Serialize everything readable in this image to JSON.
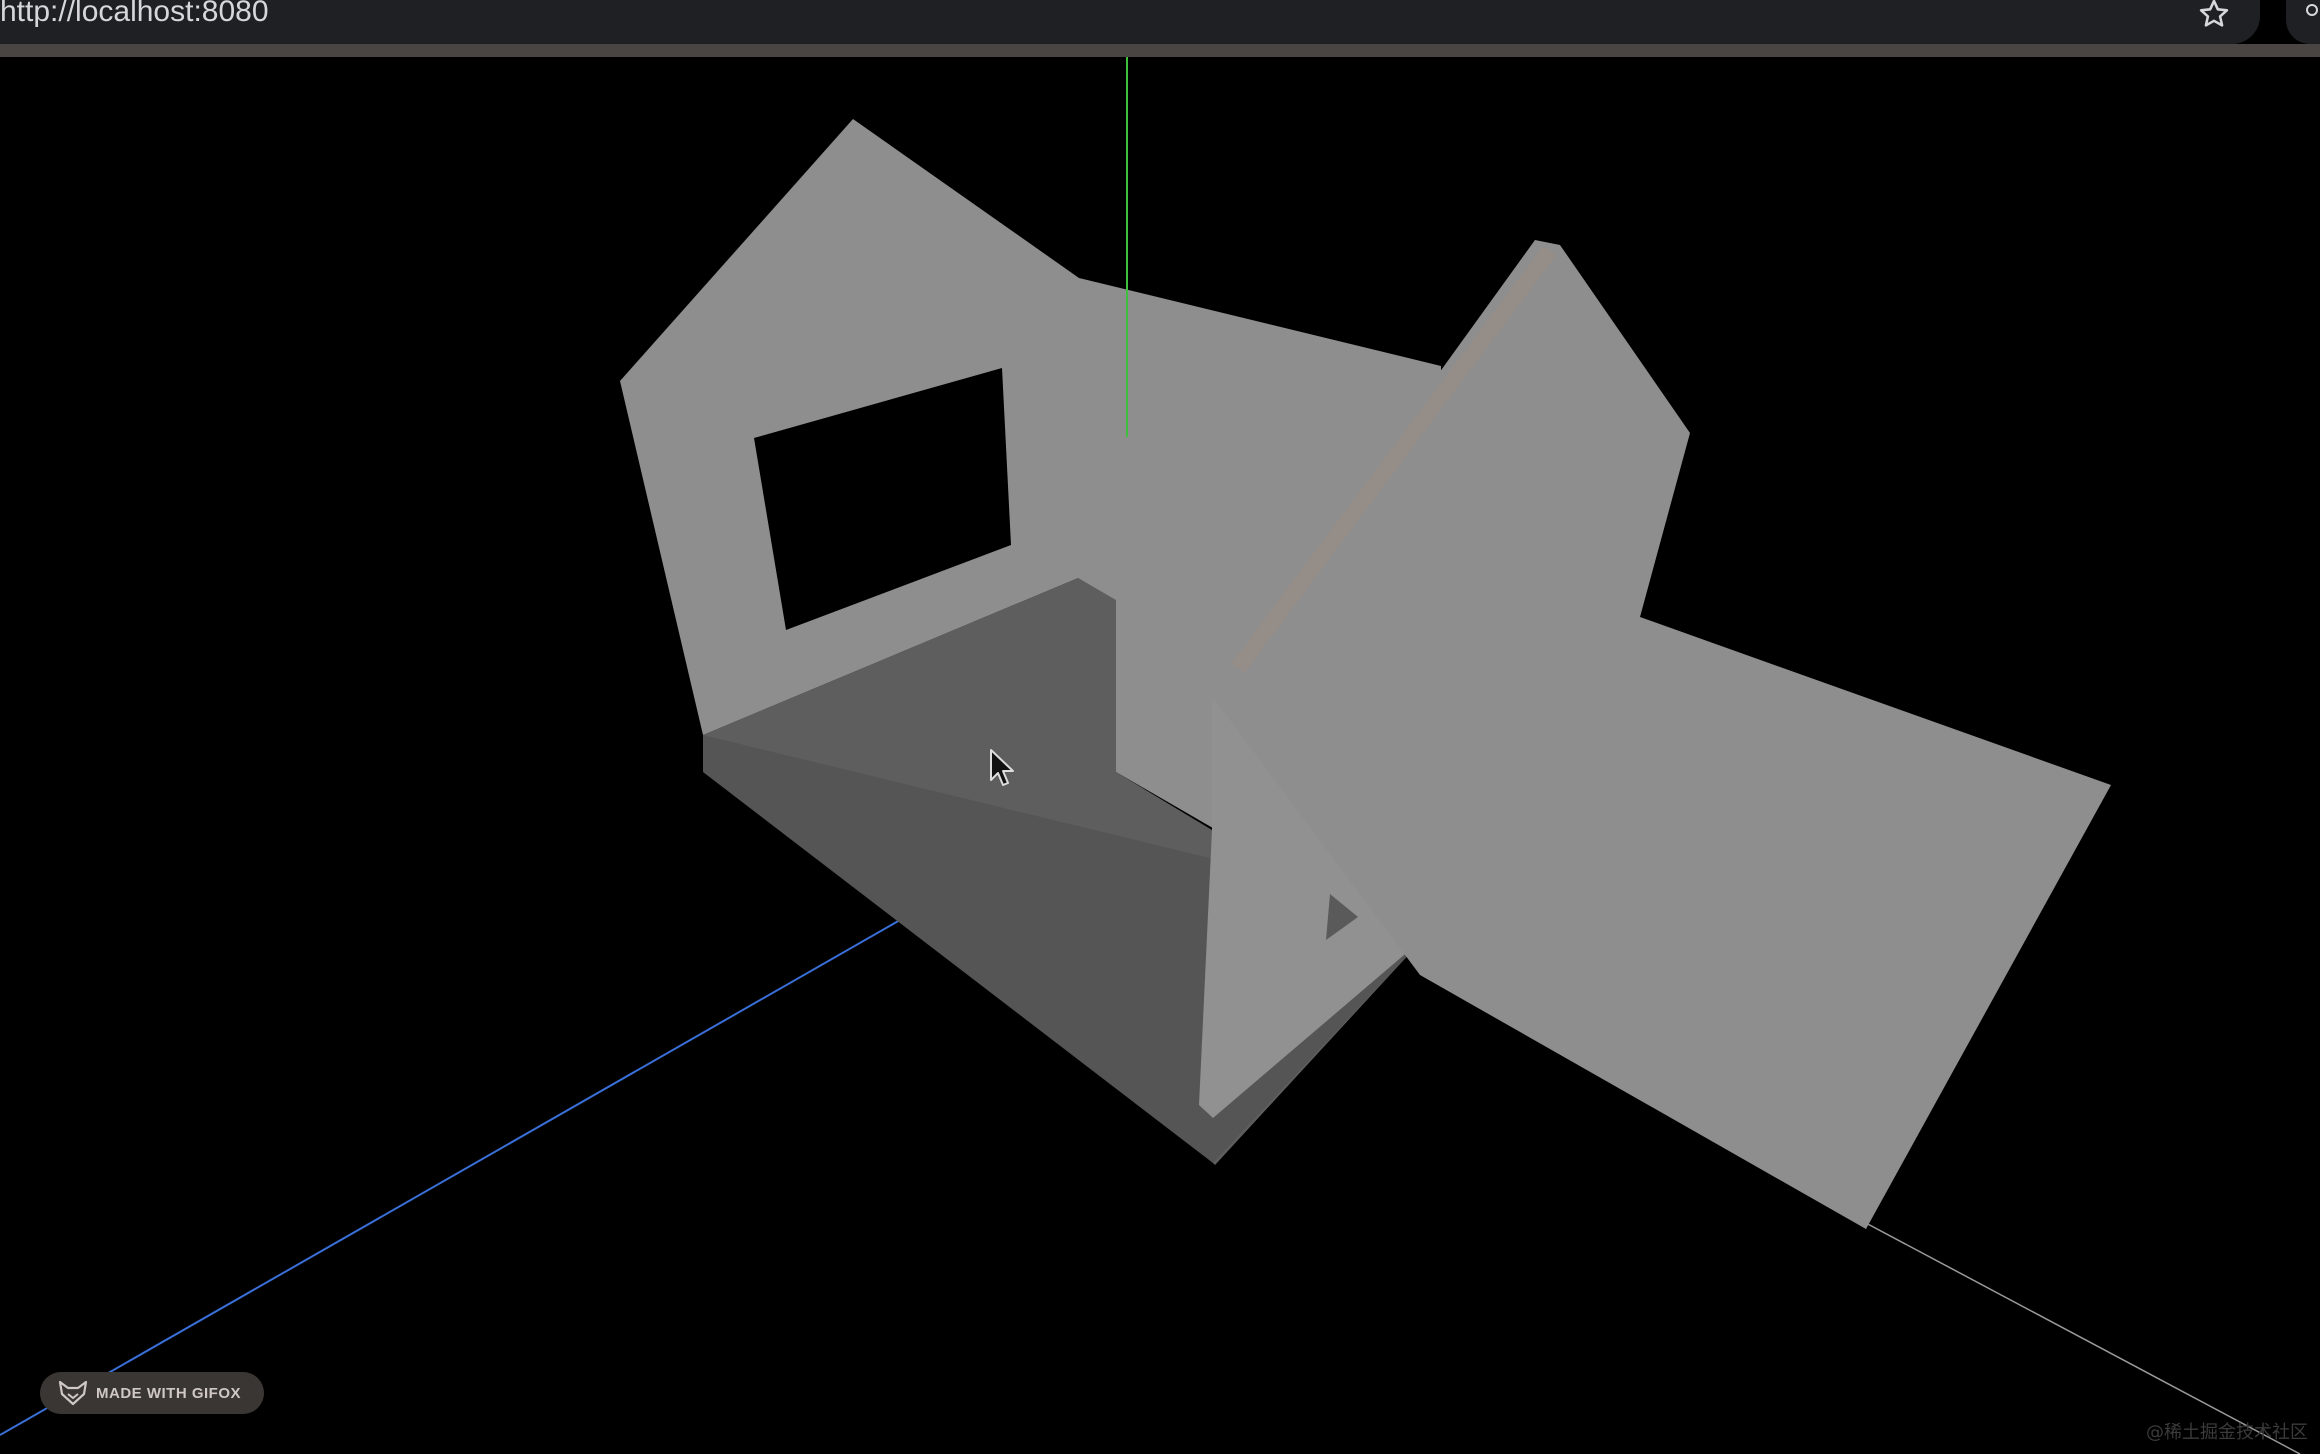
{
  "browser": {
    "url": "http://localhost:8080",
    "star_icon": "star-icon",
    "extension_icon": "extension-icon"
  },
  "scene": {
    "background": "#000000",
    "wall_color": "#8e8e8e",
    "floor_color": "#5e5e5e",
    "window_color": "#000000",
    "y_axis_color": "#3fbf3f",
    "z_axis_color": "#3a6fd8",
    "x_axis_color": "#9a9a9a",
    "cursor_icon": "mouse-pointer-icon"
  },
  "overlay": {
    "gifox_label": "MADE WITH GIFOX",
    "gifox_icon": "fox-icon",
    "watermark": "@稀土掘金技术社区"
  }
}
